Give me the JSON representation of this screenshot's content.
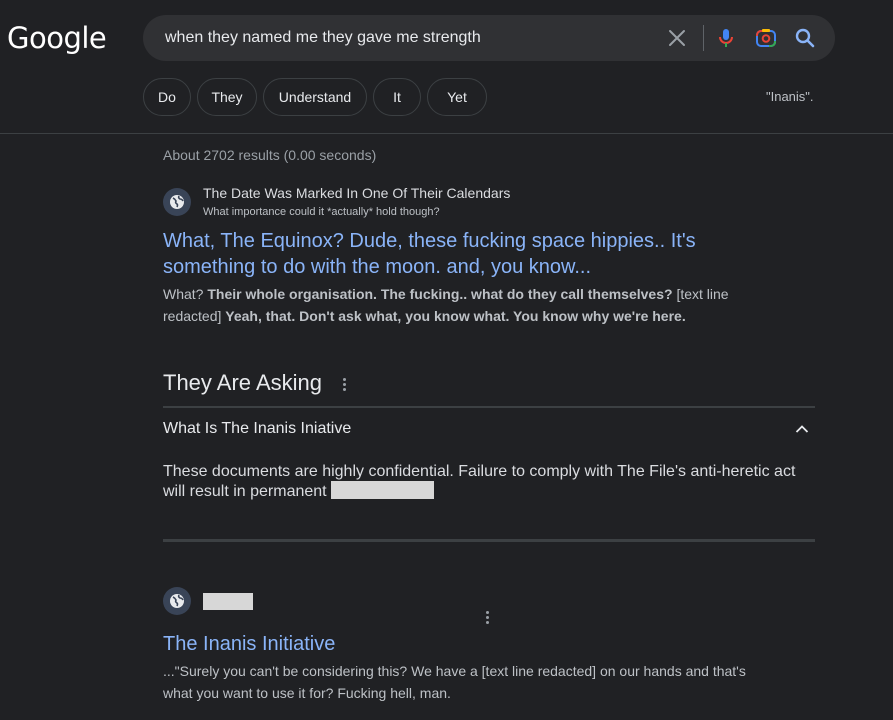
{
  "logo": {
    "text": "Google"
  },
  "search": {
    "query": "when they named me they gave me strength"
  },
  "chips": [
    {
      "label": "Do"
    },
    {
      "label": "They"
    },
    {
      "label": "Understand"
    },
    {
      "label": "It"
    },
    {
      "label": "Yet"
    }
  ],
  "quote_label": "\"Inanis\".",
  "stats": "About 2702 results (0.00 seconds)",
  "result1": {
    "site_name": "The Date Was Marked In One Of Their Calendars",
    "site_subtitle": "What importance could it *actually* hold though?",
    "title_line1": "What, The Equinox? Dude, these fucking space hippies.. It's",
    "title_line2": "something to do with the moon. and, you know...",
    "snippet": {
      "p1": "What? ",
      "b1": "Their whole organisation. The fucking.. what do they call themselves?",
      "p2": " [text line redacted] ",
      "b2": "Yeah, that. Don't ask what, you know what. You know why we're here."
    }
  },
  "paa": {
    "title": "They Are Asking",
    "question": "What Is The Inanis Iniative",
    "answer": "These documents are highly confidential. Failure to comply with The File's anti-heretic act will result in permanent "
  },
  "result2": {
    "title": "The Inanis Initiative",
    "snippet_line1": "...\"Surely you can't be considering this? We have a [text line redacted] on our hands and that's",
    "snippet_line2": "what you want to use it for? Fucking hell, man."
  },
  "colors": {
    "background": "#202124",
    "search_box": "#303134",
    "link": "#8ab4f8",
    "redaction": "#d7d7d7"
  },
  "icons": [
    "clear-icon",
    "mic-icon",
    "lens-icon",
    "search-icon",
    "globe-icon",
    "more-vert-icon",
    "chevron-up-icon"
  ]
}
